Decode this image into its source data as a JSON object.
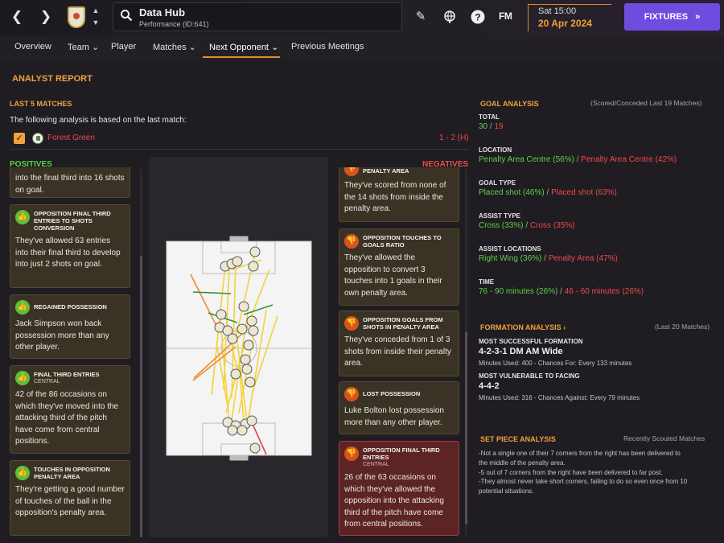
{
  "header": {
    "title": "Data Hub",
    "subtitle": "Performance (ID:641)",
    "fm_logo": "FM",
    "date_time": "Sat 15:00",
    "date_day": "20 Apr 2024",
    "fixtures_label": "FIXTURES",
    "fixtures_arrow": "»"
  },
  "tabs": [
    {
      "label": "Overview"
    },
    {
      "label": "Team",
      "chevron": "⌄"
    },
    {
      "label": "Player"
    },
    {
      "label": "Matches",
      "chevron": "⌄"
    },
    {
      "label": "Next Opponent",
      "chevron": "⌄"
    },
    {
      "label": "Previous Meetings"
    }
  ],
  "report": {
    "title": "ANALYST REPORT",
    "last5_label": "LAST 5 MATCHES",
    "basis_text": "The following analysis is based on the last match:",
    "match_team": "Forest Green",
    "match_score": "1 - 2 (H)",
    "positives_label": "POSITIVES",
    "negatives_label": "NEGATIVES"
  },
  "positives": [
    {
      "title": "",
      "sub": "",
      "body": "into the final third into 16 shots on goal.",
      "partial": true
    },
    {
      "title": "OPPOSITION FINAL THIRD ENTRIES TO SHOTS CONVERSION",
      "sub": "",
      "body": "They've allowed 63 entries into their final third to develop into just 2 shots on goal."
    },
    {
      "title": "REGAINED POSSESSION",
      "sub": "",
      "body": "Jack Simpson won back possession more than any other player."
    },
    {
      "title": "FINAL THIRD ENTRIES",
      "sub": "CENTRAL",
      "body": "42 of the 86 occasions on which they've moved into the attacking third of the pitch have come from central positions."
    },
    {
      "title": "TOUCHES IN OPPOSITION PENALTY AREA",
      "sub": "",
      "body": "They're getting a good number of touches of the ball in the opposition's penalty area."
    }
  ],
  "negatives": [
    {
      "title": "PENALTY AREA",
      "sub": "",
      "body": "They've scored from none of the 14 shots from inside the penalty area.",
      "partial": true
    },
    {
      "title": "OPPOSITION TOUCHES TO GOALS RATIO",
      "sub": "",
      "body": "They've allowed the opposition to convert 3 touches into 1 goals in their own penalty area."
    },
    {
      "title": "OPPOSITION GOALS FROM SHOTS IN PENALTY AREA",
      "sub": "",
      "body": "They've conceded from 1 of 3 shots from inside their penalty area."
    },
    {
      "title": "LOST POSSESSION",
      "sub": "",
      "body": "Luke Bolton lost possession more than any other player."
    },
    {
      "title": "OPPOSITION FINAL THIRD ENTRIES",
      "sub": "CENTRAL",
      "body": "26 of the 63 occasions on which they've allowed the opposition into the attacking third of the pitch have come from central positions.",
      "highlight": true
    }
  ],
  "goal_analysis": {
    "title": "GOAL ANALYSIS",
    "note": "(Scored/Conceded Last 19 Matches)",
    "total_label": "TOTAL",
    "total_scored": "30",
    "total_conceded": "19",
    "location_label": "LOCATION",
    "location_scored": "Penalty Area Centre (56%)",
    "location_conceded": "Penalty Area Centre (42%)",
    "goal_type_label": "GOAL TYPE",
    "goal_type_scored": "Placed shot (46%)",
    "goal_type_conceded": "Placed shot (63%)",
    "assist_type_label": "ASSIST TYPE",
    "assist_type_scored": "Cross (33%)",
    "assist_type_conceded": "Cross (35%)",
    "assist_loc_label": "ASSIST LOCATIONS",
    "assist_loc_scored": "Right Wing (36%)",
    "assist_loc_conceded": "Penalty Area (47%)",
    "time_label": "TIME",
    "time_scored": "76 - 90 minutes (26%)",
    "time_conceded": "46 - 60 minutes (26%)",
    "separator": " / "
  },
  "formation": {
    "title": "FORMATION ANALYSIS",
    "title_arrow": "›",
    "note": "(Last 20 Matches)",
    "best_label": "MOST SUCCESSFUL FORMATION",
    "best_value": "4-2-3-1 DM AM Wide",
    "best_detail": "Minutes Used: 400 - Chances For: Every 133 minutes",
    "worst_label": "MOST VULNERABLE TO FACING",
    "worst_value": "4-4-2",
    "worst_detail": "Minutes Used: 316 - Chances Against: Every 79 minutes"
  },
  "set_piece": {
    "title": "SET PIECE ANALYSIS",
    "note": "Recently Scouted Matches",
    "lines": [
      "-Not a single one of their 7 corners from the right has been delivered to",
      "the middle of the penalty area.",
      "-5 out of 7 corners from the right have been delivered to far post.",
      "-They almost never take short corners, failing to do so even once from 10",
      "potential situations."
    ]
  },
  "colors": {
    "accent": "#f0a33c",
    "positive": "#5fd146",
    "negative": "#ee4b4b",
    "fixtures": "#6d4de0"
  }
}
